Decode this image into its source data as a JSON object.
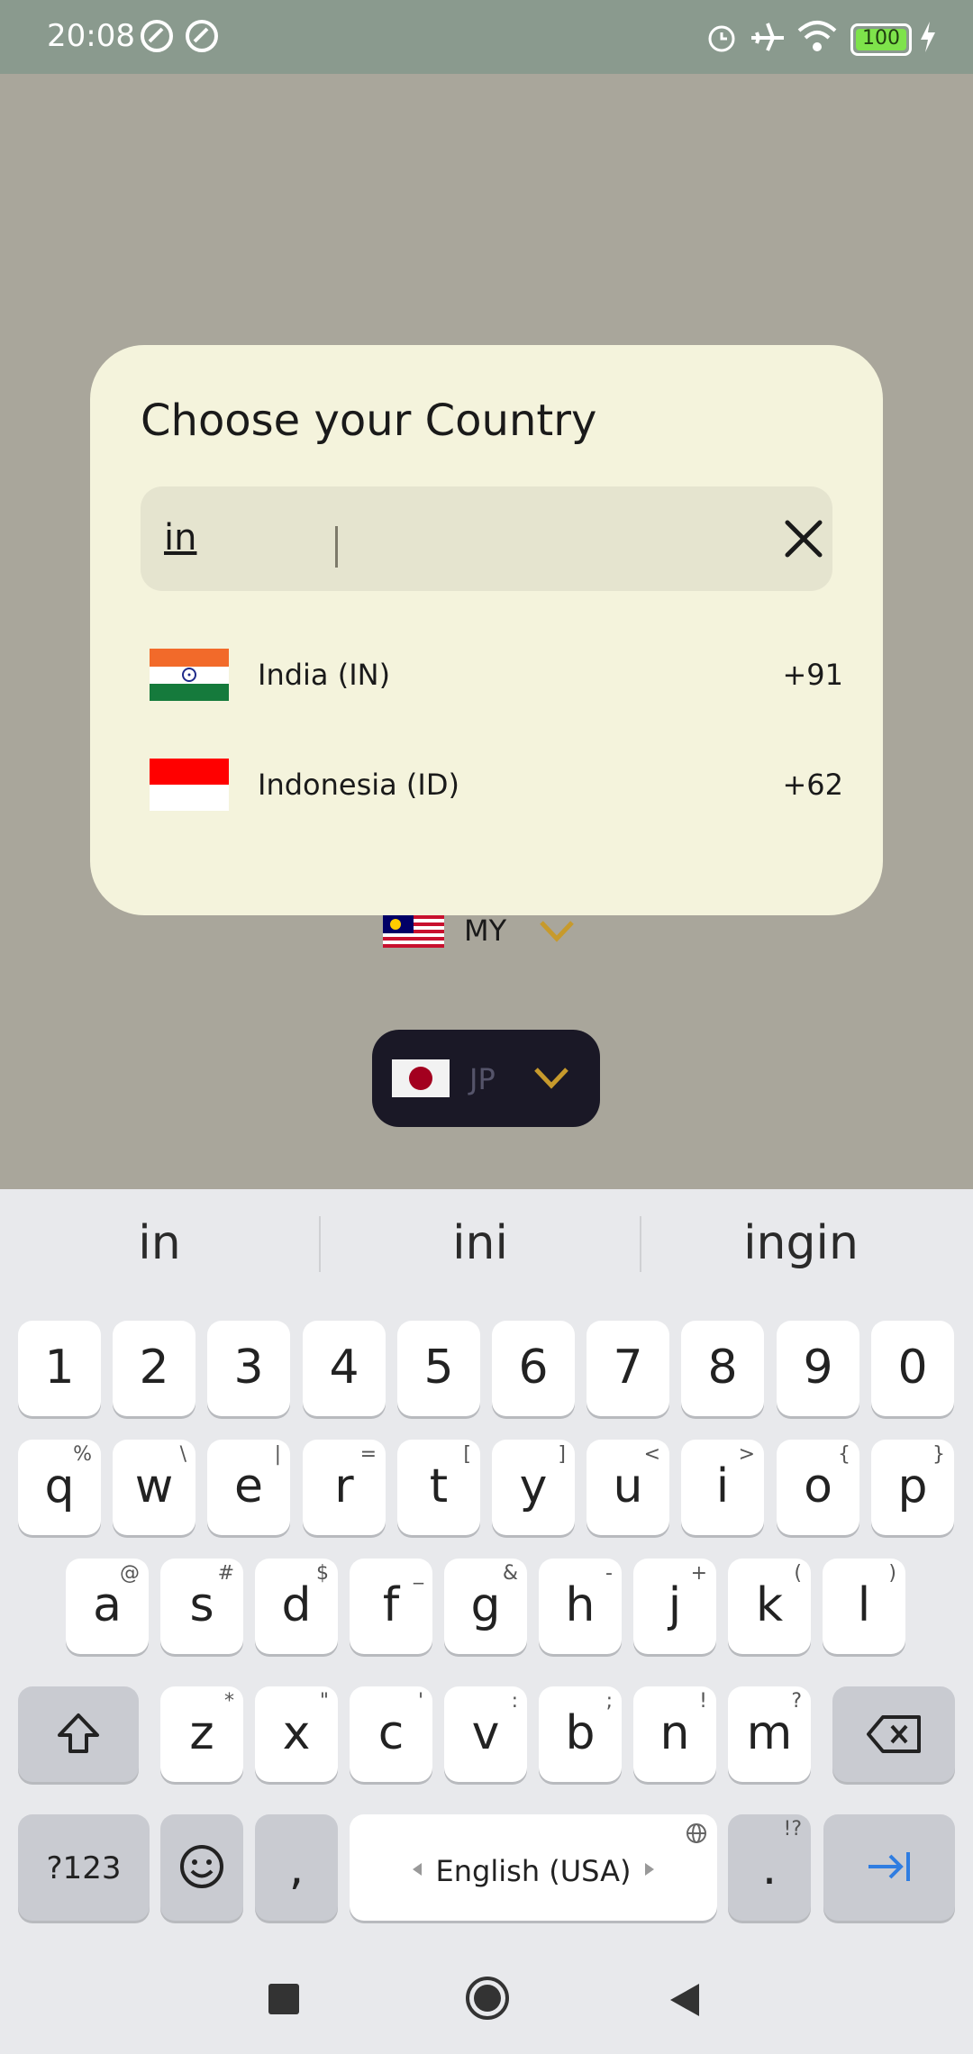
{
  "status_bar": {
    "time": "20:08",
    "battery": "100",
    "icons": [
      "alarm-icon",
      "airplane-icon",
      "wifi-icon",
      "battery-icon",
      "charging-icon"
    ]
  },
  "background": {
    "selector_my": "MY",
    "selector_jp": "JP"
  },
  "dialog": {
    "title": "Choose your Country",
    "search": {
      "value": "in"
    },
    "countries": [
      {
        "name": "India (IN)",
        "code": "+91",
        "flag": "india-flag"
      },
      {
        "name": "Indonesia (ID)",
        "code": "+62",
        "flag": "indonesia-flag"
      }
    ]
  },
  "keyboard": {
    "suggestions": [
      "in",
      "ini",
      "ingin"
    ],
    "numbers": [
      "1",
      "2",
      "3",
      "4",
      "5",
      "6",
      "7",
      "8",
      "9",
      "0"
    ],
    "row1": [
      {
        "k": "q",
        "s": "%"
      },
      {
        "k": "w",
        "s": "\\"
      },
      {
        "k": "e",
        "s": "|"
      },
      {
        "k": "r",
        "s": "="
      },
      {
        "k": "t",
        "s": "["
      },
      {
        "k": "y",
        "s": "]"
      },
      {
        "k": "u",
        "s": "<"
      },
      {
        "k": "i",
        "s": ">"
      },
      {
        "k": "o",
        "s": "{"
      },
      {
        "k": "p",
        "s": "}"
      }
    ],
    "row2": [
      {
        "k": "a",
        "s": "@"
      },
      {
        "k": "s",
        "s": "#"
      },
      {
        "k": "d",
        "s": "$"
      },
      {
        "k": "f",
        "s": "_"
      },
      {
        "k": "g",
        "s": "&"
      },
      {
        "k": "h",
        "s": "-"
      },
      {
        "k": "j",
        "s": "+"
      },
      {
        "k": "k",
        "s": "("
      },
      {
        "k": "l",
        "s": ")"
      }
    ],
    "row3": [
      {
        "k": "z",
        "s": "*"
      },
      {
        "k": "x",
        "s": "\""
      },
      {
        "k": "c",
        "s": "'"
      },
      {
        "k": "v",
        "s": ":"
      },
      {
        "k": "b",
        "s": ";"
      },
      {
        "k": "n",
        "s": "!"
      },
      {
        "k": "m",
        "s": "?"
      }
    ],
    "symbols_label": "?123",
    "comma": ",",
    "space_label": "English (USA)",
    "period": ".",
    "period_sub": "!?"
  }
}
